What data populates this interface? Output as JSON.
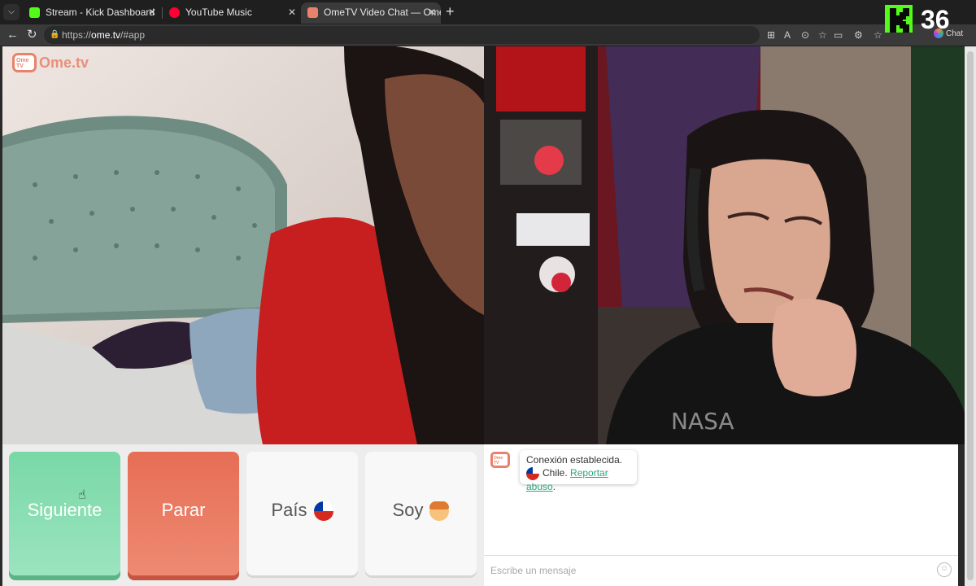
{
  "browser": {
    "tabs": [
      {
        "label": "Stream - Kick Dashboard",
        "favicon_color": "#53fc18"
      },
      {
        "label": "YouTube Music",
        "favicon_color": "#ff0033"
      },
      {
        "label": "OmeTV Video Chat — Omegl",
        "favicon_color": "#e8826a"
      }
    ],
    "close_glyph": "✕",
    "url_prefix": "https://",
    "url_host": "ome.tv",
    "url_path": "/#app"
  },
  "overlay": {
    "kick_count": "36",
    "chat_label": "Chat"
  },
  "app": {
    "logo_text": "Ome.tv",
    "logo_badge": "Ome TV"
  },
  "controls": {
    "next_label": "Siguiente",
    "stop_label": "Parar",
    "country_label": "País",
    "gender_label": "Soy"
  },
  "chat": {
    "status": "Conexión establecida.",
    "country": "Chile.",
    "report_link": "Reportar abuso",
    "report_suffix": ".",
    "input_placeholder": "Escribe un mensaje"
  },
  "colors": {
    "next_button": "#79d8a6",
    "stop_button": "#e66e55",
    "brand": "#e8826a",
    "kick_green": "#53fc18"
  },
  "icons": [
    "back-icon",
    "reload-icon",
    "lock-icon",
    "star-icon",
    "kick-logo-icon",
    "chile-flag-icon",
    "boy-emoji-icon",
    "smiley-icon"
  ]
}
